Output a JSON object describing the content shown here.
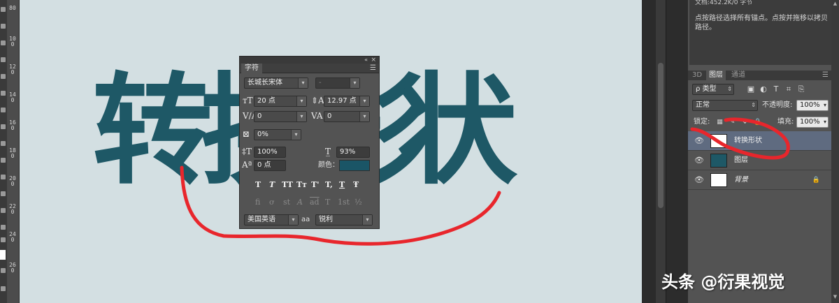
{
  "canvas": {
    "background": "#d3dfe2",
    "text_color": "#1e5866",
    "glyphs": [
      "转",
      "换",
      "形",
      "状"
    ]
  },
  "ruler": {
    "labels": [
      "80",
      "100",
      "120",
      "140",
      "160",
      "180",
      "200",
      "220",
      "240",
      "260"
    ]
  },
  "character_panel": {
    "collapse_icon": "«",
    "close_icon": "×",
    "tab": "字符",
    "menu_icon": "☰",
    "font_family": "长城长宋体",
    "font_style": "-",
    "font_size": "20 点",
    "leading": "12.97 点",
    "kerning": "0",
    "tracking": "0",
    "tsume": "0%",
    "vertical_scale": "100%",
    "horizontal_scale": "93%",
    "baseline_shift": "0 点",
    "color_label": "颜色：",
    "color": "#1a5566",
    "style_buttons": [
      "T",
      "T",
      "TT",
      "Tт",
      "T'",
      "T,",
      "T",
      "Ŧ"
    ],
    "opentype_buttons": [
      "fi",
      "ơ",
      "st",
      "A",
      "ad",
      "T",
      "1st",
      "½"
    ],
    "language": "美国英语",
    "aa_label": "aa",
    "antialias": "锐利"
  },
  "info_panel": {
    "doc_info": "文档:452.2K/0 字节",
    "hint": "点按路径选择所有锚点。点按并拖移以拷贝路径。"
  },
  "layers_panel": {
    "tabs": [
      "3D",
      "图层",
      "通道"
    ],
    "active_tab": "图层",
    "filter_kind": "ρ 类型",
    "blend_mode": "正常",
    "opacity_label": "不透明度:",
    "opacity": "100%",
    "lock_label": "锁定:",
    "fill_label": "填充:",
    "fill": "100%",
    "layers": [
      {
        "name": "转换形状",
        "selected": true,
        "thumb_color": "#ffffff",
        "italic": false
      },
      {
        "name": "图层",
        "selected": false,
        "thumb_color": "#1e5866",
        "italic": false
      },
      {
        "name": "背景",
        "selected": false,
        "thumb_color": "#ffffff",
        "italic": true
      }
    ]
  },
  "annotation_color": "#e8262c",
  "watermark": "头条 @衍果视觉"
}
